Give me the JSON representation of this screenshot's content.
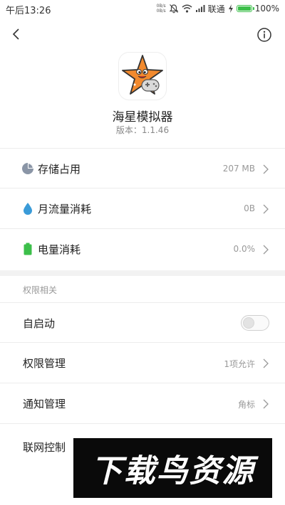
{
  "status_bar": {
    "time": "午后13:26",
    "net_speed_up": "0B/s",
    "net_speed_down": "0B/s",
    "carrier": "联通",
    "battery_percent": "100%",
    "battery_level": 1.0,
    "icons": [
      "mute-icon",
      "wifi-icon",
      "signal-icon",
      "charging-icon",
      "battery-icon"
    ]
  },
  "nav": {
    "back_icon": "back-arrow-icon",
    "info_icon": "info-icon"
  },
  "app": {
    "icon": "starfish-gamepad-app-icon",
    "name": "海星模拟器",
    "version": "版本：1.1.46"
  },
  "usage": [
    {
      "label": "存储占用",
      "value": "207 MB",
      "icon": "storage-pie-icon",
      "color": "#8a95a6"
    },
    {
      "label": "月流量消耗",
      "value": "0B",
      "icon": "data-drop-icon",
      "color": "#3a9bd8"
    },
    {
      "label": "电量消耗",
      "value": "0.0%",
      "icon": "battery-usage-icon",
      "color": "#3cbf4a"
    }
  ],
  "permissions": {
    "section_title": "权限相关",
    "autostart": {
      "label": "自启动",
      "enabled": false
    },
    "items": [
      {
        "label": "权限管理",
        "value": "1项允许"
      },
      {
        "label": "通知管理",
        "value": "角标"
      },
      {
        "label": "联网控制",
        "value": ""
      }
    ]
  },
  "watermark": {
    "text": "下载鸟资源"
  }
}
